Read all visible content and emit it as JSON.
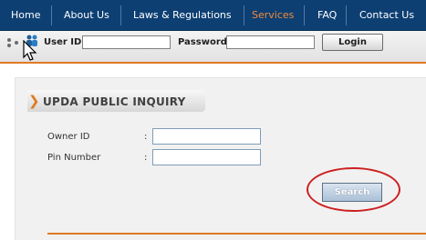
{
  "nav": {
    "items": [
      {
        "label": "Home"
      },
      {
        "label": "About Us"
      },
      {
        "label": "Laws & Regulations"
      },
      {
        "label": "Services"
      },
      {
        "label": "FAQ"
      },
      {
        "label": "Contact Us"
      }
    ],
    "active_item": "Services",
    "active_color": "#f08a3c",
    "background_color": "#0d3f73"
  },
  "login": {
    "user_id_label": "User ID:",
    "user_id_value": "",
    "password_label": "Password:",
    "password_value": "",
    "login_button_label": "Login",
    "accent_color": "#e07a22"
  },
  "inquiry": {
    "heading": "UPDA PUBLIC INQUIRY",
    "fields": [
      {
        "label": "Owner ID",
        "separator": ":",
        "value": ""
      },
      {
        "label": "Pin Number",
        "separator": ":",
        "value": ""
      }
    ],
    "search_button_label": "Search"
  },
  "icons": [
    "share-icon",
    "users-icon",
    "mouse-pointer-icon"
  ]
}
